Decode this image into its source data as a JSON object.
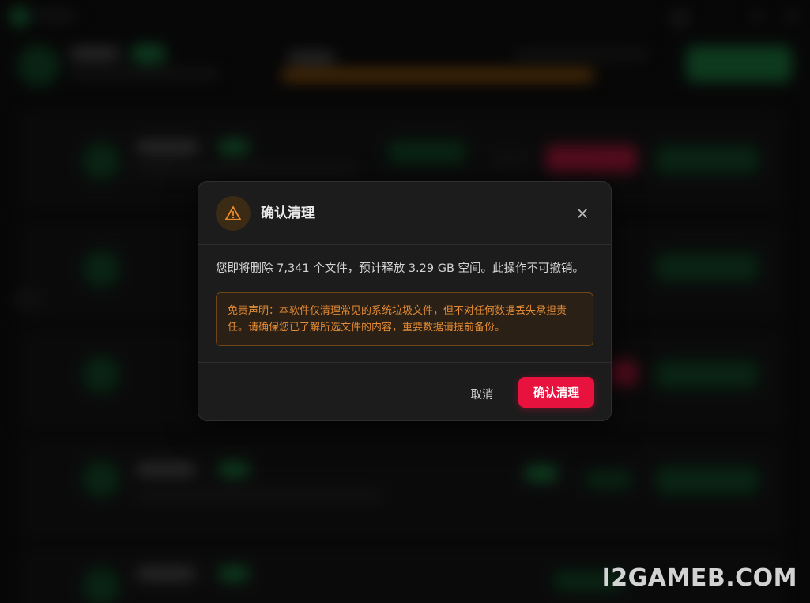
{
  "dialog": {
    "title": "确认清理",
    "message": "您即将删除 7,341 个文件，预计释放 3.29 GB 空间。此操作不可撤销。",
    "disclaimer": "免责声明：本软件仅清理常见的系统垃圾文件，但不对任何数据丢失承担责任。请确保您已了解所选文件的内容，重要数据请提前备份。",
    "cancel_label": "取消",
    "confirm_label": "确认清理",
    "icons": {
      "header": "warning-icon",
      "close": "close-icon"
    }
  },
  "watermark": "I2GAMEB.COM",
  "colors": {
    "confirm": "#e8123f",
    "warning": "#e8892b",
    "dialog_bg": "#1c1c1c",
    "notice_border": "#6e4617"
  }
}
